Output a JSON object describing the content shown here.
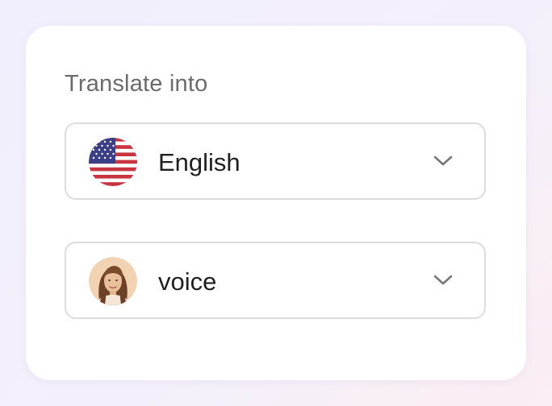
{
  "panel": {
    "heading": "Translate into"
  },
  "language_select": {
    "selected": "English",
    "icon": "us-flag-icon"
  },
  "voice_select": {
    "selected": "voice",
    "icon": "voice-avatar"
  },
  "colors": {
    "card": "#ffffff",
    "heading_text": "#6b6b6b",
    "value_text": "#1f1f1f",
    "border": "#dcdcdc",
    "chevron": "#777777",
    "flag_red": "#c8343f",
    "flag_blue": "#3b3f86"
  }
}
